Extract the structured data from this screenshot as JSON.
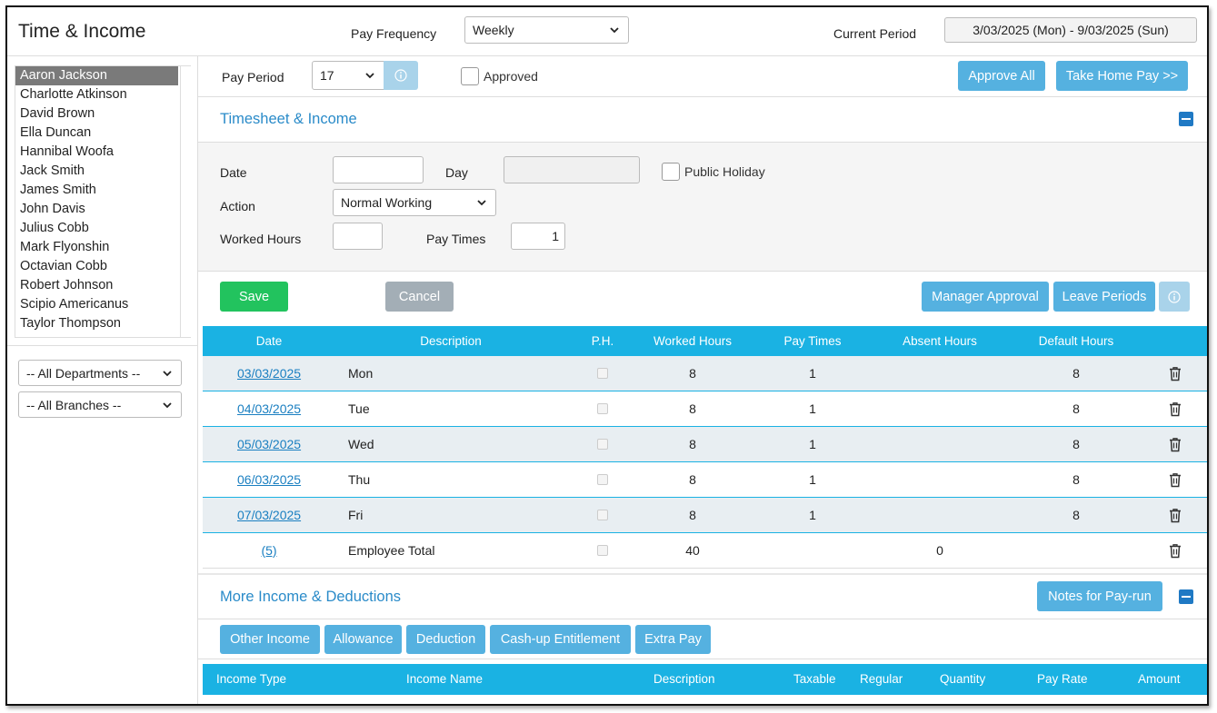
{
  "header": {
    "app_title": "Time & Income",
    "pay_frequency_label": "Pay Frequency",
    "pay_frequency_value": "Weekly",
    "current_period_label": "Current Period",
    "current_period_value": "3/03/2025 (Mon) - 9/03/2025 (Sun)"
  },
  "sidebar": {
    "employees": [
      "Aaron Jackson",
      "Charlotte Atkinson",
      "David Brown",
      "Ella Duncan",
      "Hannibal Woofa",
      "Jack Smith",
      "James Smith",
      "John Davis",
      "Julius Cobb",
      "Mark Flyonshin",
      "Octavian Cobb",
      "Robert Johnson",
      "Scipio Americanus",
      "Taylor Thompson"
    ],
    "selected_employee": "Aaron Jackson",
    "department_filter": "-- All Departments --",
    "branch_filter": "-- All Branches --"
  },
  "toolbar": {
    "pay_period_label": "Pay Period",
    "pay_period_value": "17",
    "approved_label": "Approved",
    "approve_all_label": "Approve All",
    "take_home_pay_label": "Take Home Pay >>"
  },
  "timesheet": {
    "section_title": "Timesheet & Income",
    "form": {
      "date_label": "Date",
      "date_value": "",
      "day_label": "Day",
      "day_value": "",
      "public_holiday_label": "Public Holiday",
      "action_label": "Action",
      "action_value": "Normal Working",
      "worked_hours_label": "Worked Hours",
      "worked_hours_value": "",
      "pay_times_label": "Pay Times",
      "pay_times_value": "1"
    },
    "buttons": {
      "save": "Save",
      "cancel": "Cancel",
      "manager_approval": "Manager Approval",
      "leave_periods": "Leave Periods"
    },
    "columns": [
      "Date",
      "Description",
      "P.H.",
      "Worked Hours",
      "Pay Times",
      "Absent Hours",
      "Default Hours"
    ],
    "rows": [
      {
        "date": "03/03/2025",
        "description": "Mon",
        "worked_hours": "8",
        "pay_times": "1",
        "absent_hours": "",
        "default_hours": "8"
      },
      {
        "date": "04/03/2025",
        "description": "Tue",
        "worked_hours": "8",
        "pay_times": "1",
        "absent_hours": "",
        "default_hours": "8"
      },
      {
        "date": "05/03/2025",
        "description": "Wed",
        "worked_hours": "8",
        "pay_times": "1",
        "absent_hours": "",
        "default_hours": "8"
      },
      {
        "date": "06/03/2025",
        "description": "Thu",
        "worked_hours": "8",
        "pay_times": "1",
        "absent_hours": "",
        "default_hours": "8"
      },
      {
        "date": "07/03/2025",
        "description": "Fri",
        "worked_hours": "8",
        "pay_times": "1",
        "absent_hours": "",
        "default_hours": "8"
      }
    ],
    "total": {
      "count": "(5)",
      "description": "Employee Total",
      "worked_hours": "40",
      "absent_hours": "0"
    }
  },
  "more_income": {
    "section_title": "More Income & Deductions",
    "notes_button": "Notes for Pay-run",
    "tabs": [
      "Other Income",
      "Allowance",
      "Deduction",
      "Cash-up Entitlement",
      "Extra Pay"
    ],
    "columns": [
      "Income Type",
      "Income Name",
      "Description",
      "Taxable",
      "Regular",
      "Quantity",
      "Pay Rate",
      "Amount"
    ]
  },
  "icons": {
    "info": "info-icon",
    "trash": "trash-icon",
    "chevron": "chevron-down-icon",
    "collapse": "collapse-minus-icon"
  },
  "colors": {
    "accent_blue": "#55b1e0",
    "grid_header": "#1ab2e3",
    "save_green": "#22c35e",
    "section_title": "#2a8bc9"
  }
}
